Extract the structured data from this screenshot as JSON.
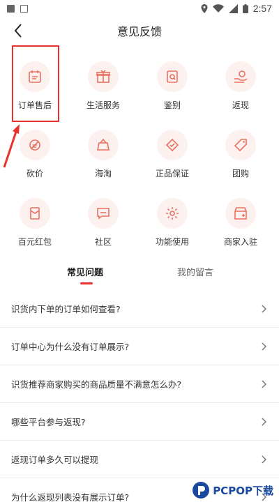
{
  "status": {
    "time": "2:57"
  },
  "header": {
    "title": "意见反馈"
  },
  "categories": [
    {
      "label": "订单售后",
      "icon": "calendar-icon"
    },
    {
      "label": "生活服务",
      "icon": "gift-icon"
    },
    {
      "label": "鉴别",
      "icon": "shield-check-icon"
    },
    {
      "label": "返现",
      "icon": "cashback-icon"
    },
    {
      "label": "砍价",
      "icon": "bargain-icon"
    },
    {
      "label": "海淘",
      "icon": "global-shopping-icon"
    },
    {
      "label": "正品保证",
      "icon": "authentic-icon"
    },
    {
      "label": "团购",
      "icon": "group-buy-tag-icon"
    },
    {
      "label": "百元红包",
      "icon": "red-envelope-icon"
    },
    {
      "label": "社区",
      "icon": "community-icon"
    },
    {
      "label": "功能使用",
      "icon": "gear-icon"
    },
    {
      "label": "商家入驻",
      "icon": "store-icon"
    }
  ],
  "tabs": [
    {
      "label": "常见问题",
      "active": true
    },
    {
      "label": "我的留言",
      "active": false
    }
  ],
  "faq": [
    "识货内下单的订单如何查看?",
    "订单中心为什么没有订单展示?",
    "识货推荐商家购买的商品质量不满意怎么办?",
    "哪些平台参与返现?",
    "返现订单多久可以提现",
    "为什么返现列表没有展示订单?"
  ],
  "watermark": {
    "text": "PCPOP下载"
  },
  "colors": {
    "accent": "#e8312b",
    "icon_bg": "#fdf1ef",
    "icon_stroke": "#e9705f"
  }
}
